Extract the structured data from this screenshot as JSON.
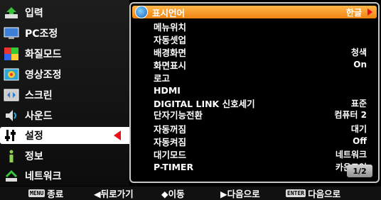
{
  "sidebar": {
    "items": [
      {
        "label": "입력",
        "icon": "input-icon"
      },
      {
        "label": "PC조정",
        "icon": "pc-monitor-icon"
      },
      {
        "label": "화질모드",
        "icon": "color-blocks-icon"
      },
      {
        "label": "영상조정",
        "icon": "image-adjust-icon"
      },
      {
        "label": "스크린",
        "icon": "screen-icon"
      },
      {
        "label": "사운드",
        "icon": "speaker-icon"
      },
      {
        "label": "설정",
        "icon": "settings-icon"
      },
      {
        "label": "정보",
        "icon": "info-icon"
      },
      {
        "label": "네트워크",
        "icon": "network-icon"
      }
    ],
    "selected_index": 6
  },
  "menu": {
    "rows": [
      {
        "label": "표시언어",
        "value": "한글"
      },
      {
        "label": "메뉴위치",
        "value": ""
      },
      {
        "label": "자동셋업",
        "value": ""
      },
      {
        "label": "배경화면",
        "value": "청색"
      },
      {
        "label": "화면표시",
        "value": "On"
      },
      {
        "label": "로고",
        "value": ""
      },
      {
        "label": "HDMI",
        "value": ""
      },
      {
        "label": "DIGITAL LINK 신호세기",
        "value": "표준"
      },
      {
        "label": "단자기능전환",
        "value": "컴퓨터 2"
      },
      {
        "label": "자동꺼짐",
        "value": "대기"
      },
      {
        "label": "자동켜짐",
        "value": "Off"
      },
      {
        "label": "대기모드",
        "value": "네트워크"
      },
      {
        "label": "P-TIMER",
        "value": "카운트업"
      }
    ],
    "page_indicator": "1/2"
  },
  "help": {
    "menu_key": "MENU",
    "end": "종료",
    "back": "◀뒤로가기",
    "move": "◆이동",
    "next": "▶다음으로",
    "enter_key": "ENTER",
    "enter_next": "다음으로"
  },
  "colors": {
    "accent": "#f08412",
    "selected_arrow": "#e8101a"
  }
}
